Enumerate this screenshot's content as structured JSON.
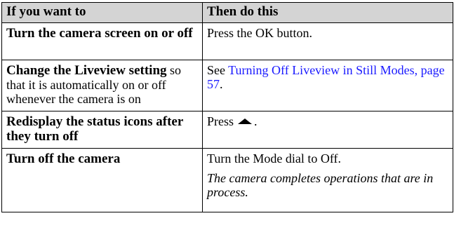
{
  "table": {
    "headers": [
      "If you want to",
      "Then do this"
    ],
    "rows": [
      {
        "action": "Turn the camera screen on or off",
        "instruction": "Press the OK button."
      },
      {
        "action_bold": "Change the Liveview setting",
        "action_rest": "so that it is automatically on or off whenever the camera is on",
        "instruction_prefix": "See ",
        "instruction_link": "Turning Off Liveview in Still Modes, page 57",
        "instruction_suffix": "."
      },
      {
        "action": "Redisplay the status icons after they turn off",
        "instruction_prefix": "Press",
        "instruction_icon": "up-arrow-icon",
        "instruction_suffix": "."
      },
      {
        "action": "Turn off the camera",
        "instruction": "Turn the Mode dial to Off.",
        "note": "The camera completes operations that are in process."
      }
    ]
  },
  "colors": {
    "header_bg": "#d4d4d4",
    "link": "#1a1aff",
    "border": "#000000"
  }
}
